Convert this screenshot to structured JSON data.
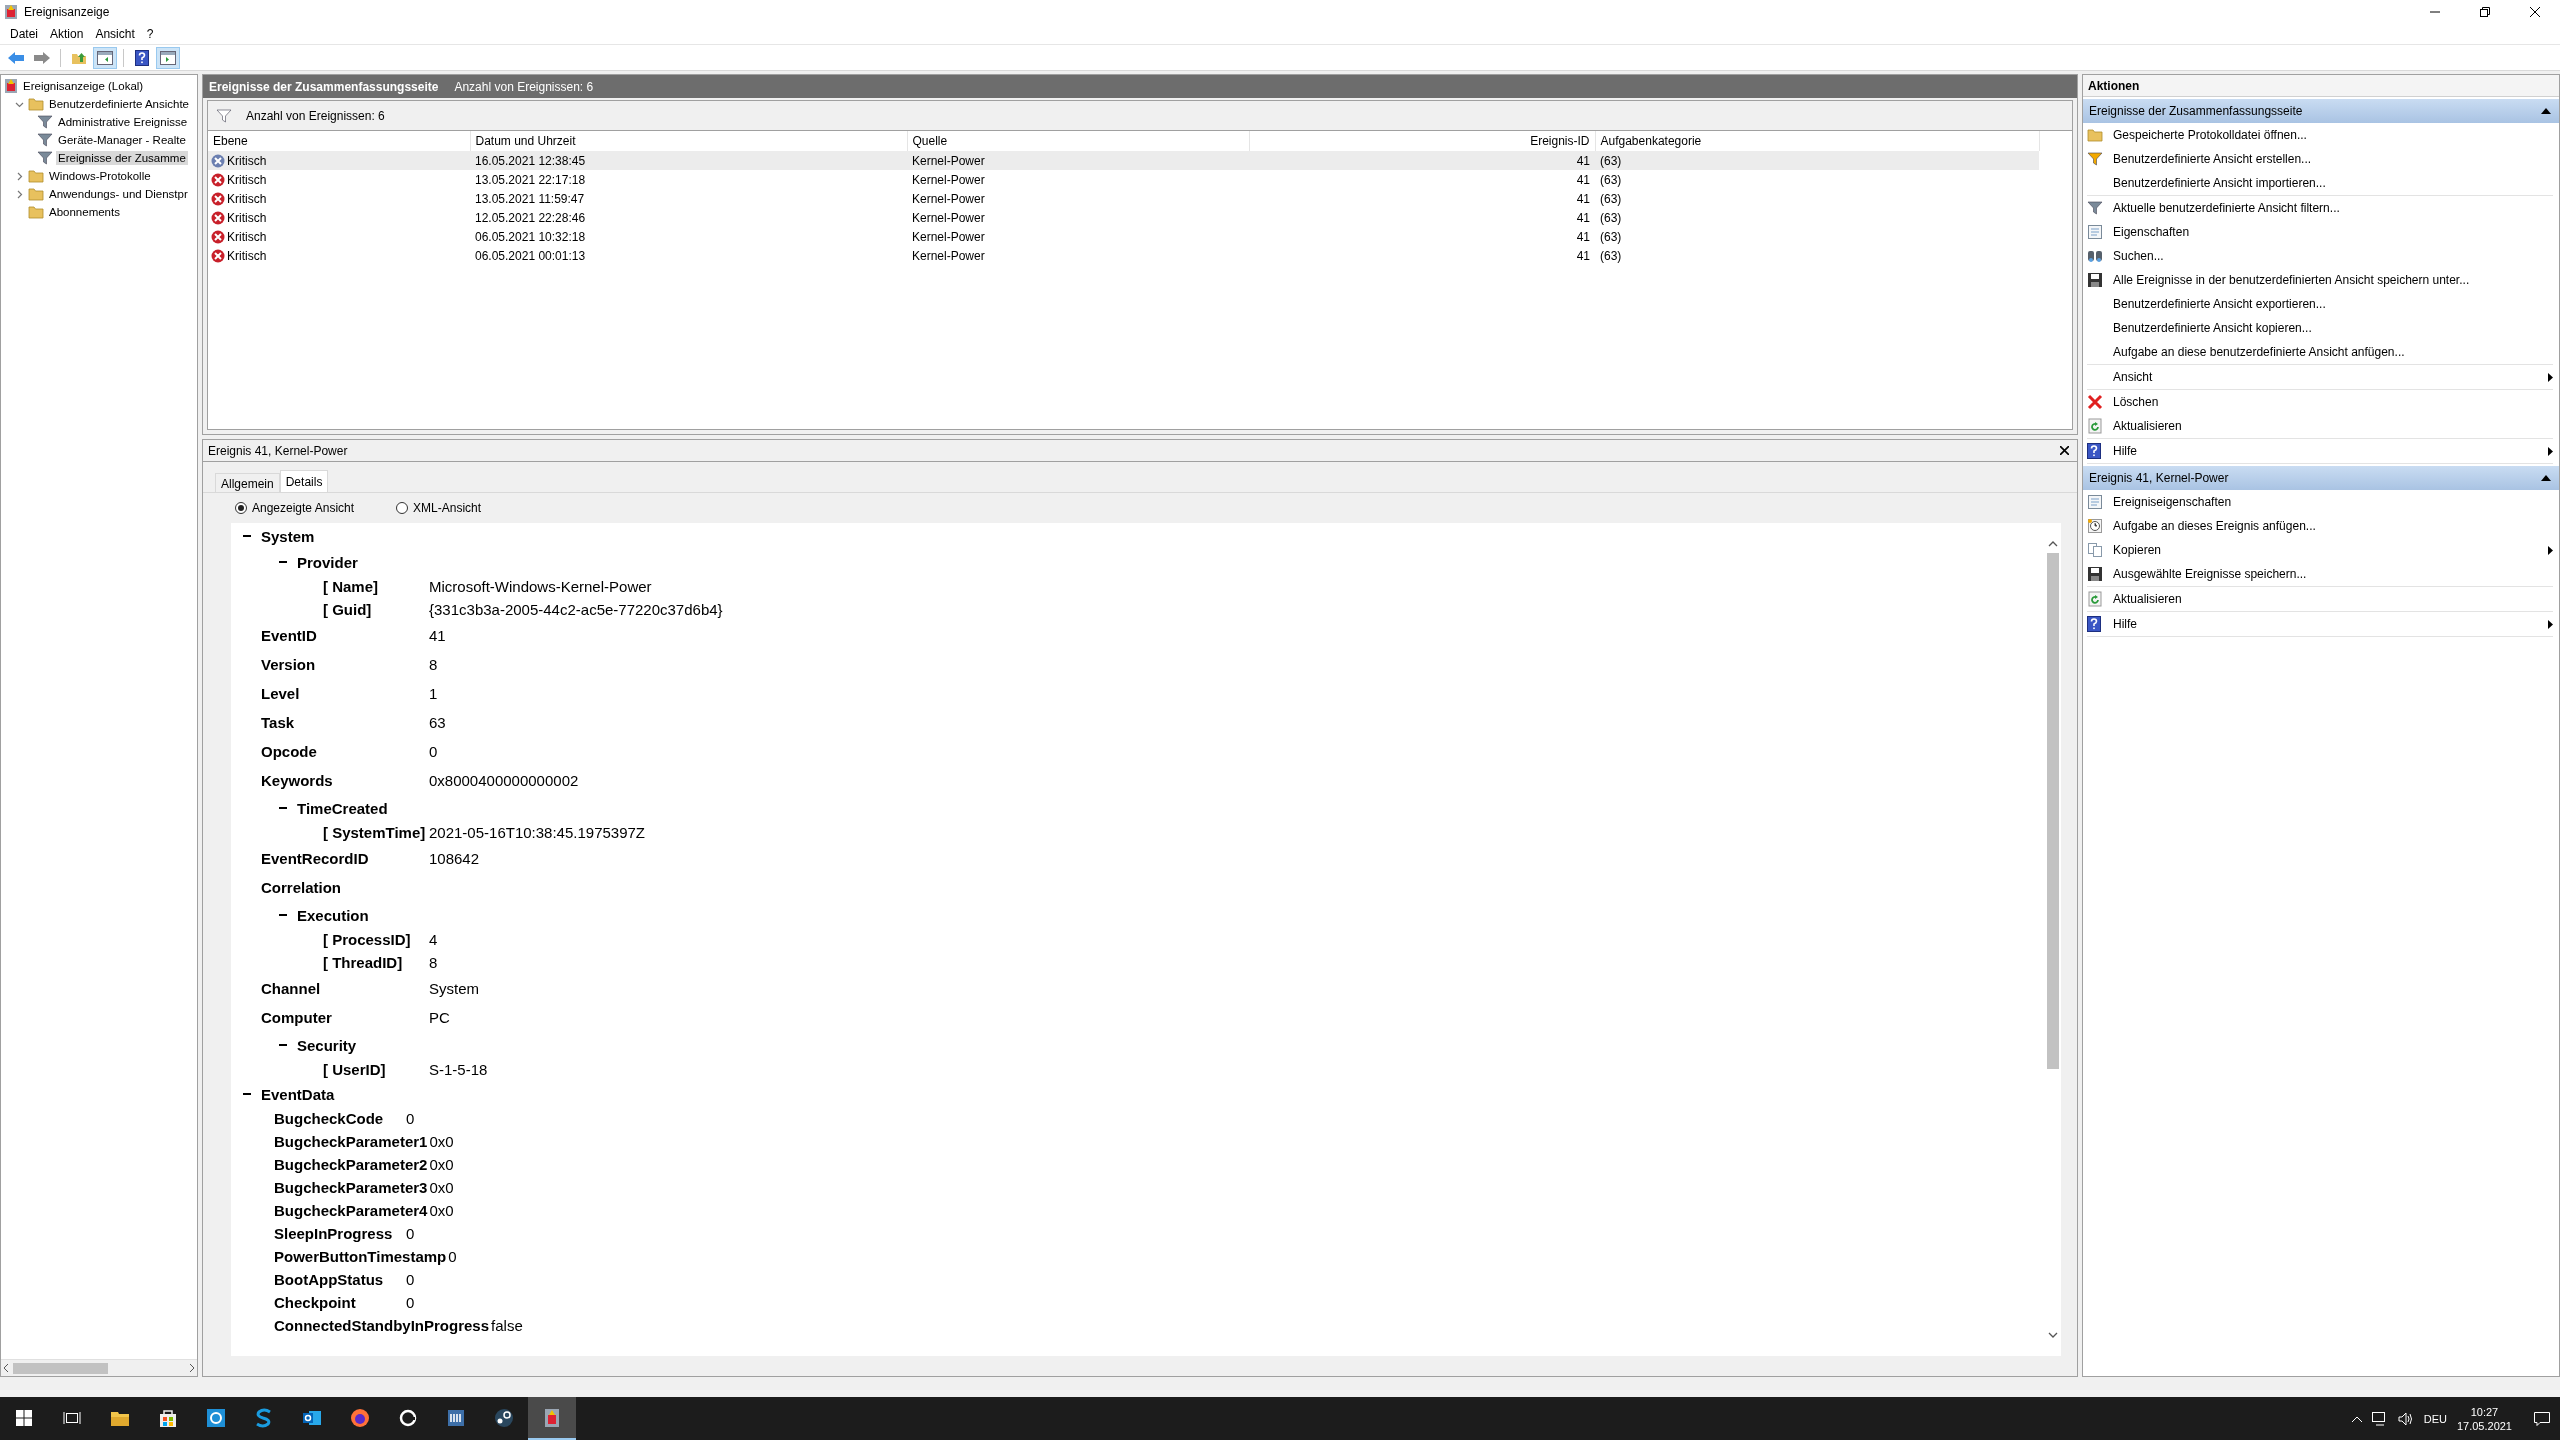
{
  "window": {
    "title": "Ereignisanzeige"
  },
  "menu": [
    "Datei",
    "Aktion",
    "Ansicht",
    "?"
  ],
  "toolbar": [
    {
      "kind": "back",
      "pressed": false
    },
    {
      "kind": "forward",
      "pressed": false
    },
    {
      "kind": "up",
      "pressed": false
    },
    {
      "kind": "tree",
      "pressed": true
    },
    {
      "kind": "help",
      "pressed": false
    },
    {
      "kind": "panel",
      "pressed": true
    }
  ],
  "tree": [
    {
      "label": "Ereignisanzeige (Lokal)",
      "selected": false,
      "children": [
        {
          "label": "Benutzerdefinierte Ansichte",
          "expanded": true,
          "selected": false,
          "children": [
            {
              "label": "Administrative Ereignisse",
              "selected": false
            },
            {
              "label": "Geräte-Manager - Realte",
              "selected": false
            },
            {
              "label": "Ereignisse der Zusamme",
              "selected": true
            }
          ]
        },
        {
          "label": "Windows-Protokolle",
          "expanded": false,
          "selected": false
        },
        {
          "label": "Anwendungs- und Dienstpr",
          "expanded": false,
          "selected": false
        },
        {
          "label": "Abonnements",
          "selected": false
        }
      ]
    }
  ],
  "summary": {
    "title": "Ereignisse der Zusammenfassungsseite",
    "count": "Anzahl von Ereignissen: 6",
    "filter": "Anzahl von Ereignissen: 6"
  },
  "table": {
    "columns": [
      {
        "label": "Ebene"
      },
      {
        "label": "Datum und Uhrzeit"
      },
      {
        "label": "Quelle"
      },
      {
        "label": "Ereignis-ID"
      },
      {
        "label": "Aufgabenkategorie"
      }
    ],
    "rows": [
      {
        "selected": true,
        "cells": [
          "Kritisch",
          "16.05.2021 12:38:45",
          "Kernel-Power",
          "41",
          "(63)"
        ]
      },
      {
        "selected": false,
        "cells": [
          "Kritisch",
          "13.05.2021 22:17:18",
          "Kernel-Power",
          "41",
          "(63)"
        ]
      },
      {
        "selected": false,
        "cells": [
          "Kritisch",
          "13.05.2021 11:59:47",
          "Kernel-Power",
          "41",
          "(63)"
        ]
      },
      {
        "selected": false,
        "cells": [
          "Kritisch",
          "12.05.2021 22:28:46",
          "Kernel-Power",
          "41",
          "(63)"
        ]
      },
      {
        "selected": false,
        "cells": [
          "Kritisch",
          "06.05.2021 10:32:18",
          "Kernel-Power",
          "41",
          "(63)"
        ]
      },
      {
        "selected": false,
        "cells": [
          "Kritisch",
          "06.05.2021 00:01:13",
          "Kernel-Power",
          "41",
          "(63)"
        ]
      }
    ]
  },
  "event": {
    "title": "Ereignis 41, Kernel-Power",
    "tabs": [
      {
        "label": "Allgemein",
        "selected": false
      },
      {
        "label": "Details",
        "selected": true
      }
    ],
    "views": [
      {
        "label": "Angezeigte Ansicht",
        "selected": true
      },
      {
        "label": "XML-Ansicht",
        "selected": false
      }
    ],
    "details": [
      {
        "kind": "group",
        "label": "System",
        "expanded": true,
        "children": [
          {
            "kind": "group",
            "label": "Provider",
            "expanded": true,
            "children": [
              {
                "kind": "attribute",
                "label": "[ Name]",
                "value": "Microsoft-Windows-Kernel-Power"
              },
              {
                "kind": "attribute",
                "label": "[ Guid]",
                "value": "{331c3b3a-2005-44c2-ac5e-77220c37d6b4}"
              }
            ]
          },
          {
            "kind": "field",
            "label": "EventID",
            "value": "41"
          },
          {
            "kind": "field",
            "label": "Version",
            "value": "8"
          },
          {
            "kind": "field",
            "label": "Level",
            "value": "1"
          },
          {
            "kind": "field",
            "label": "Task",
            "value": "63"
          },
          {
            "kind": "field",
            "label": "Opcode",
            "value": "0"
          },
          {
            "kind": "field",
            "label": "Keywords",
            "value": "0x8000400000000002"
          },
          {
            "kind": "group",
            "label": "TimeCreated",
            "expanded": true,
            "children": [
              {
                "kind": "attribute",
                "label": "[ SystemTime]",
                "value": "2021-05-16T10:38:45.1975397Z"
              }
            ]
          },
          {
            "kind": "field",
            "label": "EventRecordID",
            "value": "108642"
          },
          {
            "kind": "field",
            "label": "Correlation"
          },
          {
            "kind": "group",
            "label": "Execution",
            "expanded": true,
            "children": [
              {
                "kind": "attribute",
                "label": "[ ProcessID]",
                "value": "4"
              },
              {
                "kind": "attribute",
                "label": "[ ThreadID]",
                "value": "8"
              }
            ]
          },
          {
            "kind": "field",
            "label": "Channel",
            "value": "System"
          },
          {
            "kind": "field",
            "label": "Computer",
            "value": "PC"
          },
          {
            "kind": "group",
            "label": "Security",
            "expanded": true,
            "children": [
              {
                "kind": "attribute",
                "label": "[ UserID]",
                "value": "S-1-5-18"
              }
            ]
          }
        ]
      },
      {
        "kind": "group",
        "label": "EventData",
        "expanded": true,
        "children": [
          {
            "kind": "data",
            "label": "BugcheckCode",
            "value": "0"
          },
          {
            "kind": "data",
            "label": "BugcheckParameter1",
            "value": "0x0"
          },
          {
            "kind": "data",
            "label": "BugcheckParameter2",
            "value": "0x0"
          },
          {
            "kind": "data",
            "label": "BugcheckParameter3",
            "value": "0x0"
          },
          {
            "kind": "data",
            "label": "BugcheckParameter4",
            "value": "0x0"
          },
          {
            "kind": "data",
            "label": "SleepInProgress",
            "value": "0"
          },
          {
            "kind": "data",
            "label": "PowerButtonTimestamp",
            "value": "0"
          },
          {
            "kind": "data",
            "label": "BootAppStatus",
            "value": "0"
          },
          {
            "kind": "data",
            "label": "Checkpoint",
            "value": "0"
          },
          {
            "kind": "data",
            "label": "ConnectedStandbyInProgress",
            "value": "false"
          }
        ]
      }
    ]
  },
  "actions": {
    "title": "Aktionen",
    "sections": [
      {
        "title": "Ereignisse der Zusammenfassungsseite",
        "expanded": true,
        "groups": [
          [
            {
              "label": "Gespeicherte Protokolldatei öffnen...",
              "submenu": false
            },
            {
              "label": "Benutzerdefinierte Ansicht erstellen...",
              "submenu": false
            },
            {
              "label": "Benutzerdefinierte Ansicht importieren...",
              "submenu": false
            }
          ],
          [
            {
              "label": "Aktuelle benutzerdefinierte Ansicht filtern...",
              "submenu": false
            },
            {
              "label": "Eigenschaften",
              "submenu": false
            },
            {
              "label": "Suchen...",
              "submenu": false
            },
            {
              "label": "Alle Ereignisse in der benutzerdefinierten Ansicht speichern unter...",
              "submenu": false
            },
            {
              "label": "Benutzerdefinierte Ansicht exportieren...",
              "submenu": false
            },
            {
              "label": "Benutzerdefinierte Ansicht kopieren...",
              "submenu": false
            },
            {
              "label": "Aufgabe an diese benutzerdefinierte Ansicht anfügen...",
              "submenu": false
            }
          ],
          [
            {
              "label": "Ansicht",
              "submenu": true
            }
          ],
          [
            {
              "label": "Löschen",
              "submenu": false
            },
            {
              "label": "Aktualisieren",
              "submenu": false
            }
          ],
          [
            {
              "label": "Hilfe",
              "submenu": true
            }
          ]
        ]
      },
      {
        "title": "Ereignis 41, Kernel-Power",
        "expanded": true,
        "groups": [
          [
            {
              "label": "Ereigniseigenschaften",
              "submenu": false
            },
            {
              "label": "Aufgabe an dieses Ereignis anfügen...",
              "submenu": false
            },
            {
              "label": "Kopieren",
              "submenu": true
            },
            {
              "label": "Ausgewählte Ereignisse speichern...",
              "submenu": false
            }
          ],
          [
            {
              "label": "Aktualisieren",
              "submenu": false
            }
          ],
          [
            {
              "label": "Hilfe",
              "submenu": true
            }
          ]
        ]
      }
    ]
  },
  "taskbar": {
    "apps": [
      {
        "selected": false
      },
      {
        "selected": false
      },
      {
        "selected": false
      },
      {
        "selected": false
      },
      {
        "selected": false
      },
      {
        "selected": false
      },
      {
        "selected": false
      },
      {
        "selected": false
      },
      {
        "selected": false
      },
      {
        "selected": true
      }
    ],
    "language": "DEU",
    "time": "10:27",
    "date": "17.05.2021"
  }
}
